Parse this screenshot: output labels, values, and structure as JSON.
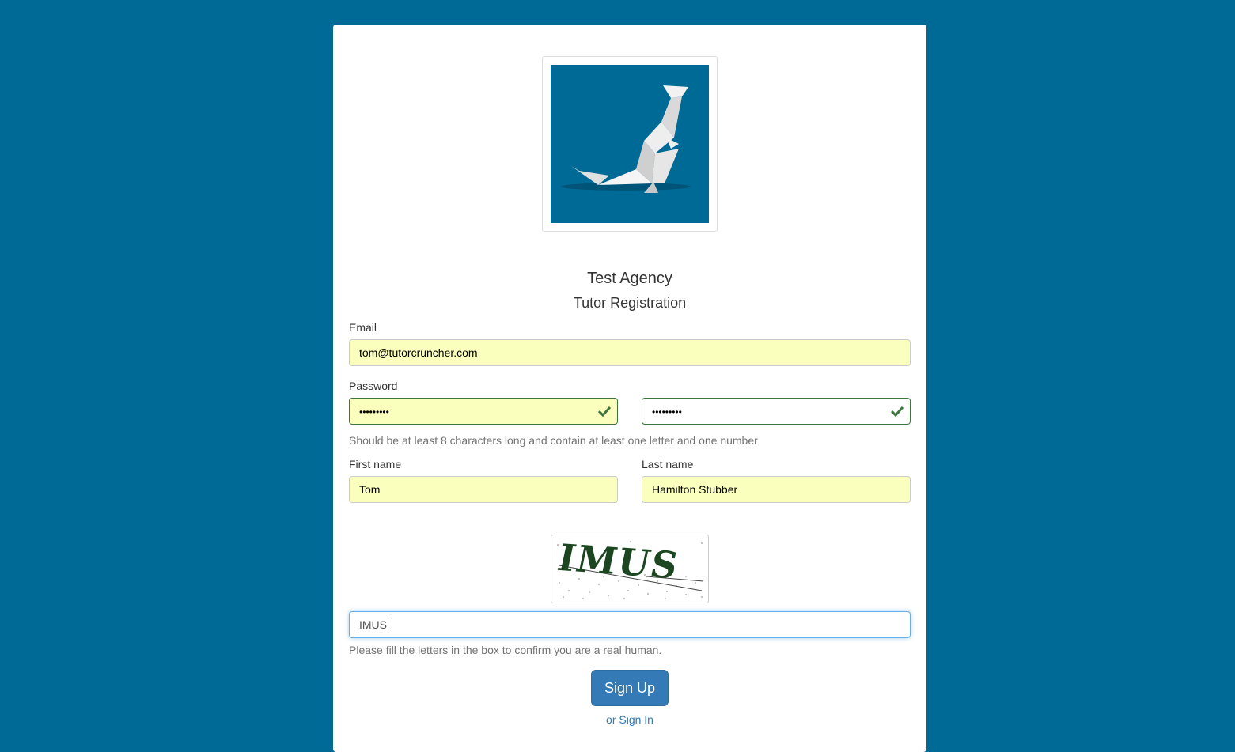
{
  "header": {
    "agency_name": "Test Agency",
    "page_title": "Tutor Registration"
  },
  "form": {
    "email": {
      "label": "Email",
      "value": "tom@tutorcruncher.com"
    },
    "password": {
      "label": "Password",
      "value_masked": "•••••••••",
      "confirm_masked": "•••••••••",
      "help": "Should be at least 8 characters long and contain at least one letter and one number"
    },
    "first_name": {
      "label": "First name",
      "value": "Tom"
    },
    "last_name": {
      "label": "Last name",
      "value": "Hamilton Stubber"
    },
    "captcha": {
      "image_text": "IMUS",
      "value": "IMUS",
      "help": "Please fill the letters in the box to confirm you are a real human."
    },
    "submit_label": "Sign Up",
    "signin_link": "or Sign In"
  },
  "icons": {
    "logo": "origami-dinosaur-logo",
    "valid": "check-icon"
  },
  "colors": {
    "page_background": "#006a96",
    "autofill_background": "#faffbd",
    "valid_border": "#3c763d",
    "primary_button": "#337ab7",
    "focus_border": "#66afe9"
  }
}
